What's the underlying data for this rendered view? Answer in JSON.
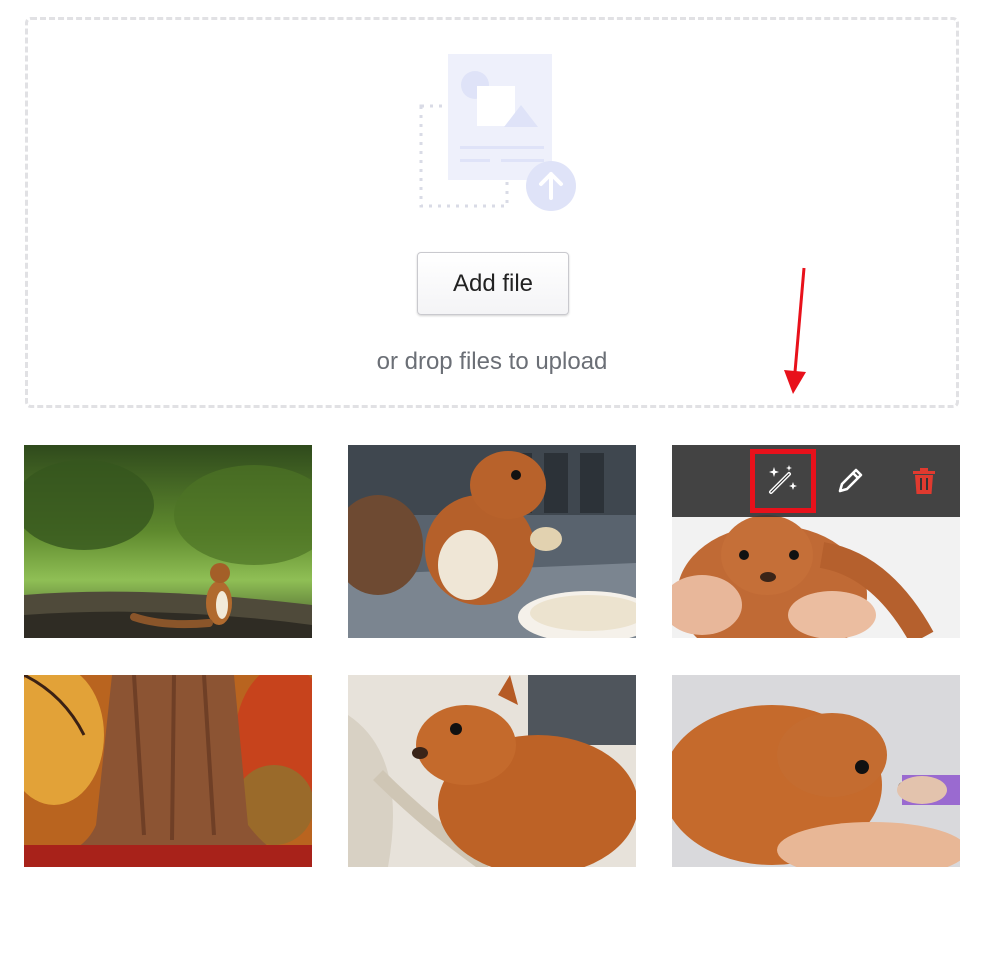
{
  "dropzone": {
    "add_file_label": "Add file",
    "drop_hint": "or drop files to upload"
  },
  "gallery": {
    "items": [
      {
        "subject": "squirrel standing on forest path"
      },
      {
        "subject": "squirrel eating peanut"
      },
      {
        "subject": "young squirrel held in hand",
        "toolbar": {
          "actions": [
            "magic-wand",
            "edit",
            "delete"
          ],
          "highlighted_action": "magic-wand"
        }
      },
      {
        "subject": "autumn tree trunk"
      },
      {
        "subject": "baby squirrel on blanket"
      },
      {
        "subject": "baby squirrel in hand"
      }
    ]
  },
  "colors": {
    "annotation_red": "#e8111b",
    "delete_red": "#e03a2f",
    "toolbar_bg": "#343434",
    "illustration_blue": "#dfe3f8"
  }
}
